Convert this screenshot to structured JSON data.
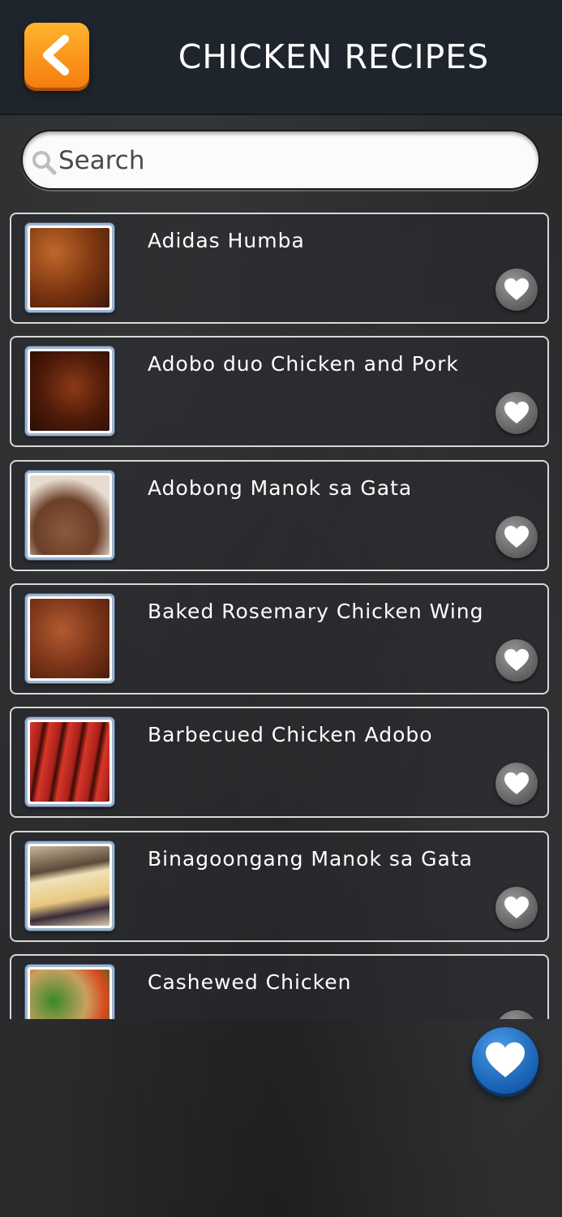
{
  "header": {
    "title": "CHICKEN RECIPES"
  },
  "search": {
    "placeholder": "Search"
  },
  "recipes": [
    {
      "name": "Adidas Humba"
    },
    {
      "name": "Adobo duo Chicken and Pork"
    },
    {
      "name": "Adobong Manok sa Gata"
    },
    {
      "name": "Baked Rosemary Chicken Wing"
    },
    {
      "name": "Barbecued Chicken Adobo"
    },
    {
      "name": "Binagoongang Manok sa Gata"
    },
    {
      "name": "Cashewed Chicken"
    }
  ],
  "colors": {
    "header_bg": "#1f252d",
    "back_button": "#f5920e",
    "favorites_button": "#1a63b5",
    "card_border": "#d8d8d8"
  },
  "icons": {
    "back": "chevron-left-icon",
    "search": "search-icon",
    "favorite": "heart-icon"
  }
}
